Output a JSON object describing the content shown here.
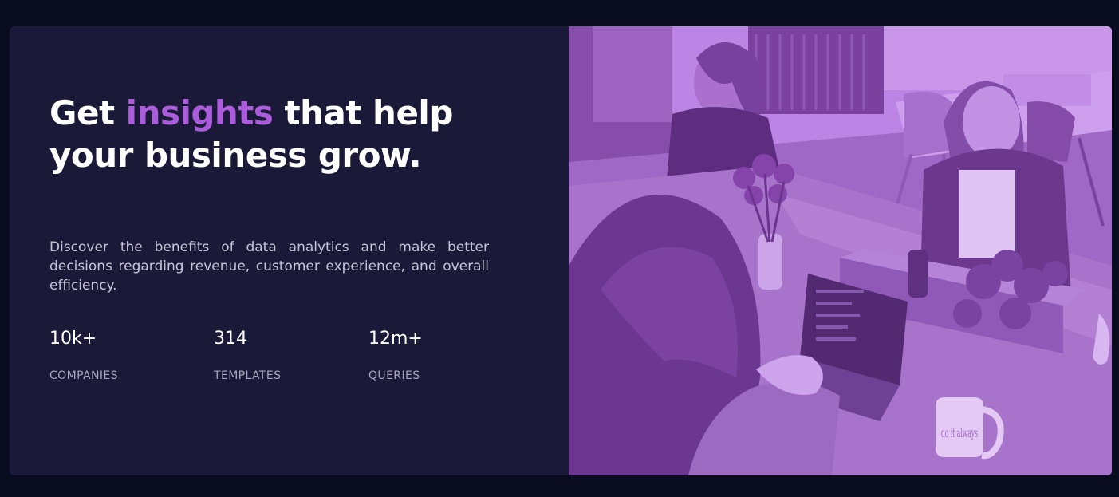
{
  "hero": {
    "headline_before": "Get ",
    "headline_accent": "insights",
    "headline_after": " that help your business grow.",
    "description": "Discover the benefits of data analytics and make better decisions regarding revenue, customer experience, and overall efficiency.",
    "accent_color": "#aa5cdb",
    "background_color": "#1b1938",
    "page_background": "#090b1f"
  },
  "stats": [
    {
      "value": "10k+",
      "label": "COMPANIES"
    },
    {
      "value": "314",
      "label": "TEMPLATES"
    },
    {
      "value": "12m+",
      "label": "QUERIES"
    }
  ],
  "image": {
    "overlay_color": "#aa5cdb",
    "mug_text": "do it always"
  }
}
